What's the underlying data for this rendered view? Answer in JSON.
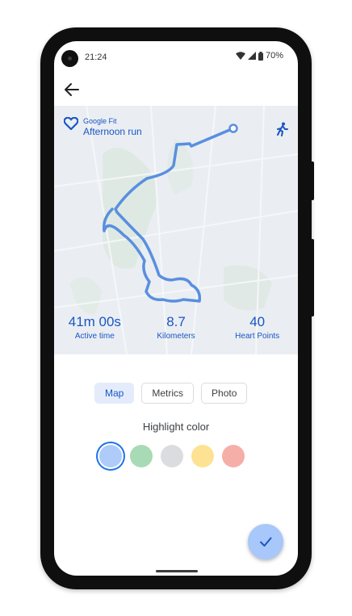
{
  "status_bar": {
    "time": "21:24",
    "battery": "70%",
    "icons": [
      "wifi-icon",
      "signal-icon",
      "battery-icon"
    ]
  },
  "header": {
    "back_icon": "arrow-back-icon"
  },
  "map_card": {
    "brand_name": "Google Fit",
    "activity_title": "Afternoon run",
    "activity_icon": "walking-person-icon",
    "stats": [
      {
        "value": "41m 00s",
        "label": "Active time"
      },
      {
        "value": "8.7",
        "label": "Kilometers"
      },
      {
        "value": "40",
        "label": "Heart Points"
      }
    ]
  },
  "tabs": [
    {
      "label": "Map",
      "active": true
    },
    {
      "label": "Metrics",
      "active": false
    },
    {
      "label": "Photo",
      "active": false
    }
  ],
  "highlight": {
    "label": "Highlight color",
    "swatches": [
      {
        "name": "blue",
        "color": "#aecbfa",
        "selected": true
      },
      {
        "name": "green",
        "color": "#a8dab5",
        "selected": false
      },
      {
        "name": "gray",
        "color": "#dadce0",
        "selected": false
      },
      {
        "name": "yellow",
        "color": "#fde293",
        "selected": false
      },
      {
        "name": "red",
        "color": "#f6aea9",
        "selected": false
      }
    ]
  },
  "fab": {
    "icon": "check-icon"
  },
  "colors": {
    "accent": "#1a56c4",
    "route": "#5a8fe0",
    "map_bg": "#eaeef2",
    "fab_bg": "#a8c7fa"
  }
}
